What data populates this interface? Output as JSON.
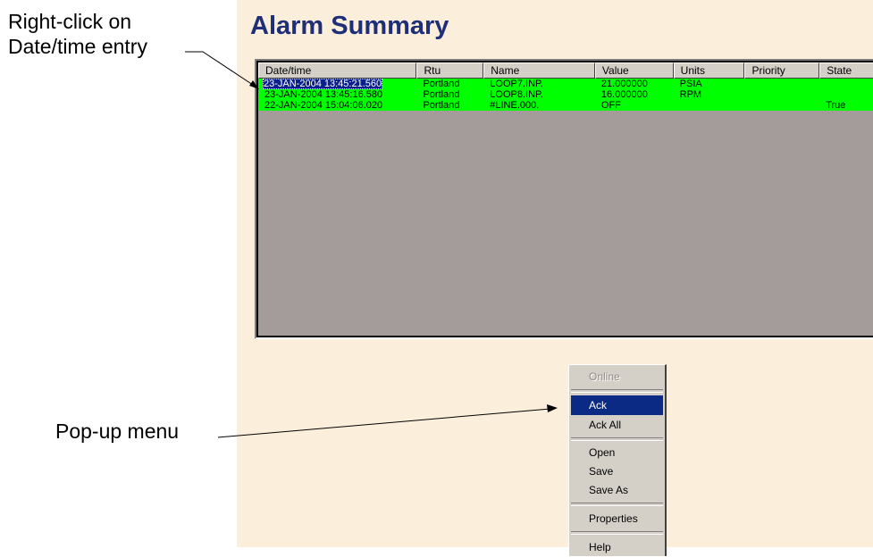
{
  "annotations": {
    "right_click_line1": "Right-click on",
    "right_click_line2": "Date/time entry",
    "popup": "Pop-up menu"
  },
  "page": {
    "title": "Alarm Summary"
  },
  "table": {
    "columns": [
      "Date/time",
      "Rtu",
      "Name",
      "Value",
      "Units",
      "Priority",
      "State"
    ],
    "rows": [
      [
        "23-JAN-2004 13:45:21.560",
        "Portland",
        "LOOP7.INP.",
        "21.000000",
        "PSIA",
        "",
        ""
      ],
      [
        "23-JAN-2004 13:45:16.580",
        "Portland",
        "LOOP8.INP.",
        "16.000000",
        "RPM",
        "",
        ""
      ],
      [
        "22-JAN-2004 15:04:06.020",
        "Portland",
        "#LINE.000.",
        "OFF",
        "",
        "",
        "True"
      ]
    ],
    "selected": "23-JAN-2004 13:45:21.560"
  },
  "context_menu": {
    "items": [
      "Online",
      "Ack",
      "Ack All",
      "Open",
      "Save",
      "Save As",
      "Properties",
      "Help"
    ],
    "disabled": "Online",
    "highlighted": "Ack"
  },
  "colors": {
    "background": "#fbeedb",
    "title": "#1e2f78",
    "row_alarm": "#00ff00",
    "grid_empty": "#a49c9b",
    "selection": "#0a1e8c",
    "menu_bg": "#d4d0c8",
    "menu_highlight": "#0a2a83"
  }
}
